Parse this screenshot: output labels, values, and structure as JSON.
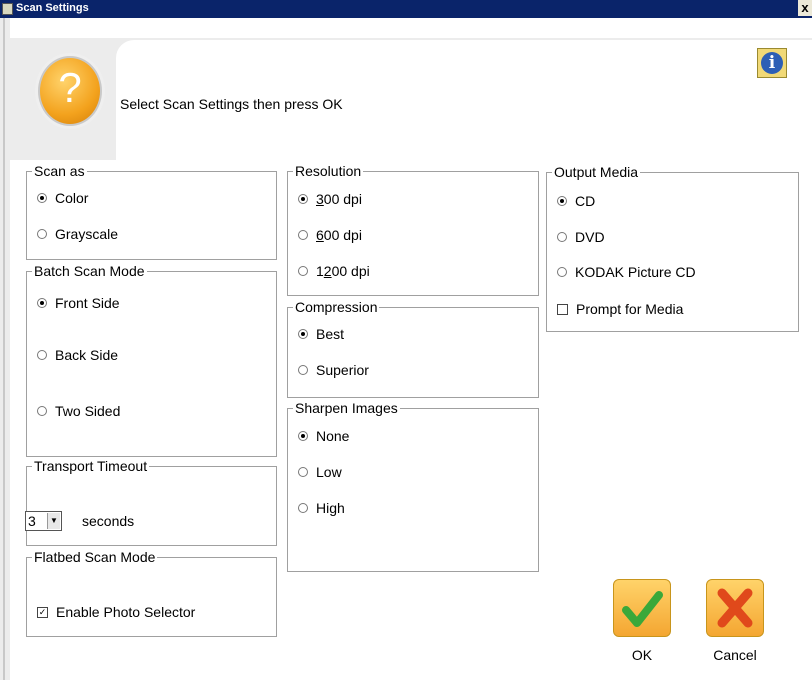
{
  "window": {
    "title": "Scan Settings",
    "close_label": "x"
  },
  "header": {
    "prompt": "Select Scan Settings then press OK",
    "question_glyph": "?",
    "info_glyph": "i"
  },
  "scan_as": {
    "title": "Scan as",
    "options": [
      {
        "label": "Color",
        "selected": true
      },
      {
        "label": "Grayscale",
        "selected": false
      }
    ]
  },
  "batch_scan_mode": {
    "title": "Batch Scan Mode",
    "options": [
      {
        "label": "Front Side",
        "selected": true
      },
      {
        "label": "Back Side",
        "selected": false
      },
      {
        "label": "Two Sided",
        "selected": false
      }
    ]
  },
  "transport_timeout": {
    "title": "Transport Timeout",
    "value": "3",
    "unit": "seconds"
  },
  "flatbed_scan_mode": {
    "title": "Flatbed Scan Mode",
    "checkbox_label": "Enable Photo Selector",
    "checked": true
  },
  "resolution": {
    "title": "Resolution",
    "options": [
      {
        "first": "3",
        "rest": "00 dpi",
        "selected": true
      },
      {
        "first": "6",
        "rest": "00 dpi",
        "selected": false
      },
      {
        "pre": "1",
        "first": "2",
        "rest": "00 dpi",
        "selected": false
      }
    ]
  },
  "compression": {
    "title": "Compression",
    "options": [
      {
        "label": "Best",
        "selected": true
      },
      {
        "label": "Superior",
        "selected": false
      }
    ]
  },
  "sharpen_images": {
    "title": "Sharpen Images",
    "options": [
      {
        "label": "None",
        "selected": true
      },
      {
        "label": "Low",
        "selected": false
      },
      {
        "label": "High",
        "selected": false
      }
    ]
  },
  "output_media": {
    "title": "Output Media",
    "options": [
      {
        "label": "CD",
        "selected": true
      },
      {
        "label": "DVD",
        "selected": false
      },
      {
        "label": "KODAK Picture CD",
        "selected": false
      }
    ],
    "prompt_checkbox": {
      "label": "Prompt for Media",
      "checked": false
    }
  },
  "buttons": {
    "ok_label": "OK",
    "cancel_label": "Cancel"
  },
  "colors": {
    "titlebar": "#0a246a",
    "button_orange": "#f4a632",
    "ok_check": "#3aa83a",
    "cancel_x": "#e0491b",
    "info_blue": "#2d5fb5"
  }
}
